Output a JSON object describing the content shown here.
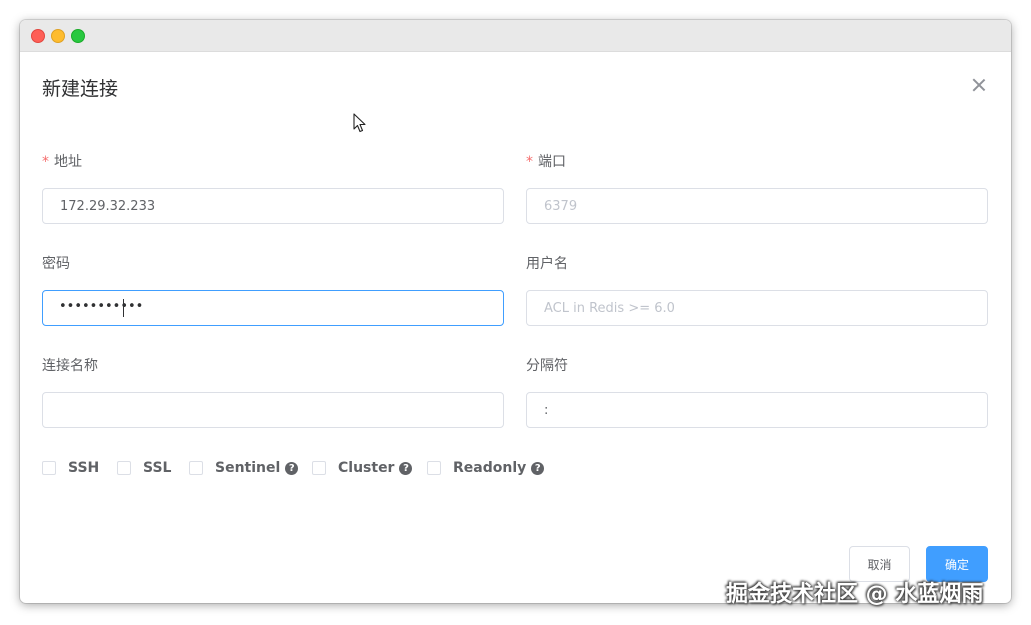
{
  "dialog": {
    "title": "新建连接"
  },
  "form": {
    "address": {
      "label": "地址",
      "required_mark": "*",
      "value": "172.29.32.233"
    },
    "port": {
      "label": "端口",
      "required_mark": "*",
      "placeholder": "6379"
    },
    "password": {
      "label": "密码",
      "masked_value": "•••••••••••"
    },
    "username": {
      "label": "用户名",
      "placeholder": "ACL in Redis >= 6.0"
    },
    "connection_name": {
      "label": "连接名称",
      "value": ""
    },
    "separator": {
      "label": "分隔符",
      "value": ":"
    }
  },
  "options": [
    {
      "label": "SSH",
      "help": false,
      "checked": false
    },
    {
      "label": "SSL",
      "help": false,
      "checked": false
    },
    {
      "label": "Sentinel",
      "help": true,
      "checked": false
    },
    {
      "label": "Cluster",
      "help": true,
      "checked": false
    },
    {
      "label": "Readonly",
      "help": true,
      "checked": false
    }
  ],
  "help_glyph": "?",
  "buttons": {
    "cancel": "取消",
    "confirm": "确定"
  },
  "watermark": "掘金技术社区 @ 水蓝烟雨",
  "colors": {
    "primary": "#409eff",
    "required": "#f56c6c",
    "close": "#fe5f57",
    "minimize": "#febc2e",
    "maximize": "#28c840"
  }
}
